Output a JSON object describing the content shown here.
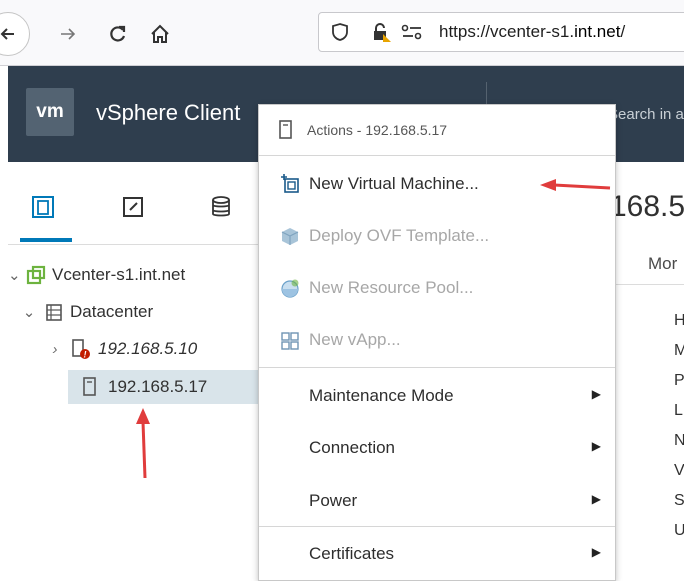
{
  "browser": {
    "url_prefix": "https://vcenter-s1.",
    "url_domain": "int.net",
    "url_suffix": "/"
  },
  "header": {
    "logo_text": "vm",
    "app_title": "vSphere Client",
    "search_placeholder": "Search in all"
  },
  "content": {
    "title_fragment": "168.5",
    "tab_fragment": "Mor",
    "letters": [
      "H",
      "M",
      "P",
      "L",
      "N",
      "V",
      "S",
      "U"
    ]
  },
  "tree": {
    "vcenter": "Vcenter-s1.int.net",
    "datacenter": "Datacenter",
    "host1": "192.168.5.10",
    "host2": "192.168.5.17"
  },
  "menu": {
    "header": "Actions - 192.168.5.17",
    "items": [
      {
        "label": "New Virtual Machine...",
        "enabled": true
      },
      {
        "label": "Deploy OVF Template...",
        "enabled": false
      },
      {
        "label": "New Resource Pool...",
        "enabled": false
      },
      {
        "label": "New vApp...",
        "enabled": false
      },
      {
        "label": "Maintenance Mode",
        "enabled": true
      },
      {
        "label": "Connection",
        "enabled": true
      },
      {
        "label": "Power",
        "enabled": true
      },
      {
        "label": "Certificates",
        "enabled": true
      }
    ]
  },
  "colors": {
    "header_bg": "#2f3e4e",
    "accent": "#0079b8",
    "annotation": "#e03c3c",
    "disabled_text": "#a7a7a7"
  }
}
